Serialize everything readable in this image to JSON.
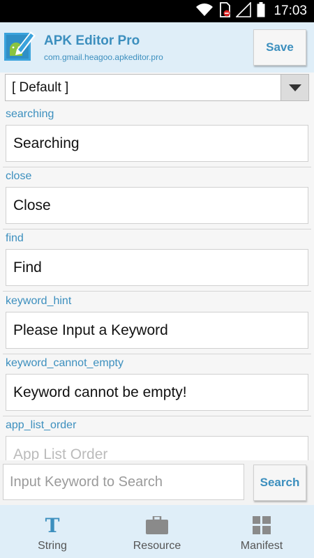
{
  "status_bar": {
    "time": "17:03",
    "icons": [
      "wifi-icon",
      "sim-blocked-icon",
      "signal-icon",
      "battery-icon"
    ]
  },
  "app_bar": {
    "title": "APK Editor Pro",
    "package": "com.gmail.heagoo.apkeditor.pro",
    "save_label": "Save",
    "icon": "apk-editor-pencil-icon"
  },
  "language_select": {
    "value": "[ Default ]"
  },
  "fields": [
    {
      "key": "searching",
      "value": "Searching"
    },
    {
      "key": "close",
      "value": "Close"
    },
    {
      "key": "find",
      "value": "Find"
    },
    {
      "key": "keyword_hint",
      "value": "Please Input a Keyword"
    },
    {
      "key": "keyword_cannot_empty",
      "value": "Keyword cannot be empty!"
    },
    {
      "key": "app_list_order",
      "value": "App List Order"
    }
  ],
  "search": {
    "placeholder": "Input Keyword to Search",
    "button_label": "Search"
  },
  "bottom_nav": [
    {
      "label": "String",
      "icon": "string-t-icon"
    },
    {
      "label": "Resource",
      "icon": "briefcase-icon"
    },
    {
      "label": "Manifest",
      "icon": "grid-icon"
    }
  ],
  "colors": {
    "accent": "#3c8fbe",
    "bar_background": "#dfeef8"
  }
}
